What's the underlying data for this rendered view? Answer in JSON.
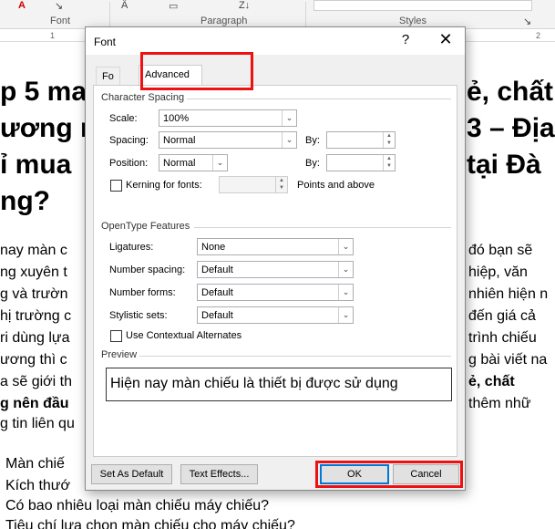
{
  "ribbon": {
    "groups": [
      "Font",
      "Paragraph",
      "Styles"
    ],
    "ruler_marks": [
      "1",
      "2"
    ]
  },
  "document": {
    "heading_lines": [
      "p 5 ma",
      "ương nê",
      "ỉ mua",
      "ng?"
    ],
    "heading_right": [
      "ẻ, chất",
      "3 – Địa",
      "tại Đà"
    ],
    "body_left": [
      "nay màn c",
      "ng xuyên t",
      "g và trườn",
      "hị trường c",
      "ri dùng lựa",
      "ương thì c",
      "a sẽ giới th",
      "g nên đầu",
      "g tin liên qu"
    ],
    "body_right": [
      "đó bạn sẽ",
      "hiệp, văn",
      "nhiên hiện n",
      "đến giá cả",
      "trình chiếu",
      "g bài viết na",
      "ẻ, chất",
      "thêm nhữ"
    ],
    "list_items": [
      "Màn chiế",
      "Kích thướ",
      "Có bao nhiêu loại màn chiếu máy chiếu?",
      "Tiêu chí lựa chọn màn chiếu cho máy chiếu?"
    ]
  },
  "dialog": {
    "title": "Font",
    "help": "?",
    "close": "✕",
    "tabs": [
      {
        "label": "Font",
        "shown": "Fo"
      },
      {
        "label": "Advanced"
      }
    ],
    "character_spacing": {
      "header": "Character Spacing",
      "scale_label": "Scale:",
      "scale_value": "100%",
      "spacing_label": "Spacing:",
      "spacing_value": "Normal",
      "by_label": "By:",
      "by_value": "",
      "position_label": "Position:",
      "position_value": "Normal",
      "by2_label": "By:",
      "by2_value": "",
      "kerning_label": "Kerning for fonts:",
      "kerning_value": "",
      "kerning_checked": false,
      "points_label": "Points and above"
    },
    "opentype": {
      "header": "OpenType Features",
      "ligatures_label": "Ligatures:",
      "ligatures_value": "None",
      "number_spacing_label": "Number spacing:",
      "number_spacing_value": "Default",
      "number_forms_label": "Number forms:",
      "number_forms_value": "Default",
      "stylistic_label": "Stylistic sets:",
      "stylistic_value": "Default",
      "contextual_label": "Use Contextual Alternates",
      "contextual_checked": false
    },
    "preview": {
      "header": "Preview",
      "text": "Hiện nay màn chiếu là thiết bị được sử dụng"
    },
    "buttons": {
      "set_default": "Set As Default",
      "text_effects": "Text Effects...",
      "ok": "OK",
      "cancel": "Cancel"
    }
  },
  "colors": {
    "highlight_box": "#ee1111",
    "ok_border": "#0078d7"
  }
}
